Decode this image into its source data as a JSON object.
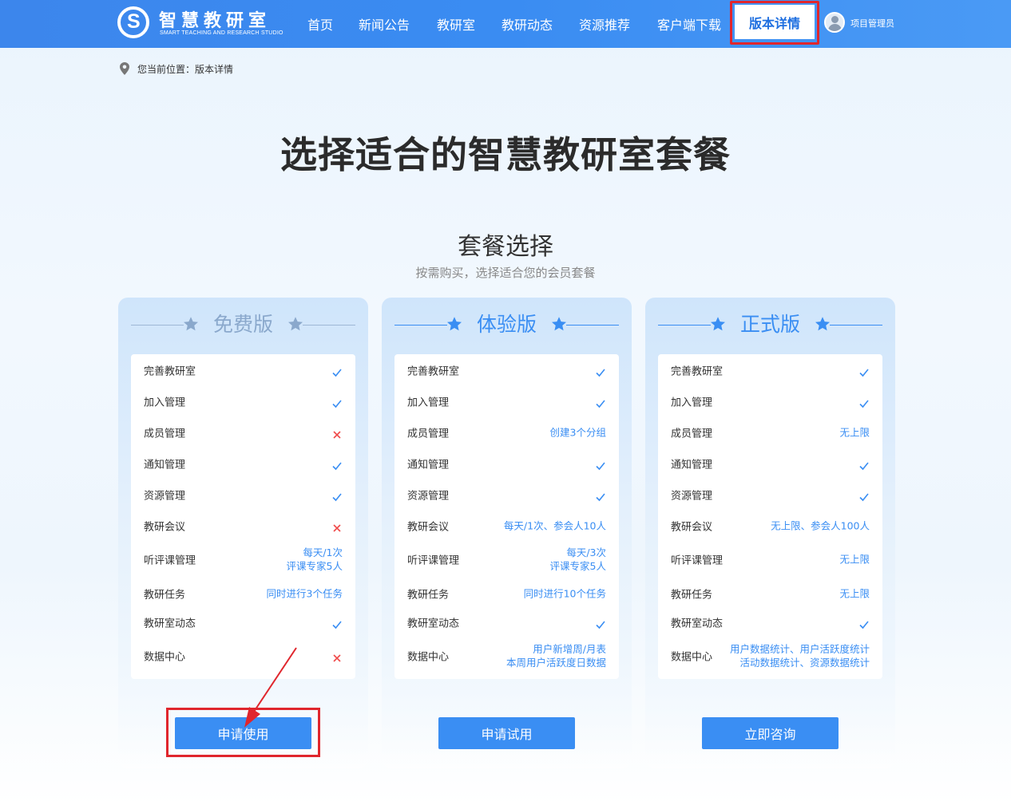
{
  "colors": {
    "brand_blue": "#3a8ef3",
    "nav_bg": "#3c86ec",
    "highlight_red": "#e0262d",
    "cross_red": "#f04a4a",
    "free_gray_blue": "#8aa8cc"
  },
  "header": {
    "logo_title": "智慧教研室",
    "logo_subtitle": "SMART TEACHING AND RESEARCH STUDIO",
    "nav": [
      "首页",
      "新闻公告",
      "教研室",
      "教研动态",
      "资源推荐",
      "客户端下载"
    ],
    "nav_active": "版本详情",
    "user_name": "项目管理员"
  },
  "breadcrumb": "您当前位置：版本详情",
  "hero_title": "选择适合的智慧教研室套餐",
  "section": {
    "title": "套餐选择",
    "subtitle": "按需购买，选择适合您的会员套餐"
  },
  "plans": [
    {
      "name": "免费版",
      "button": "申请使用",
      "features": [
        {
          "label": "完善教研室",
          "value": "",
          "mark": "check"
        },
        {
          "label": "加入管理",
          "value": "",
          "mark": "check"
        },
        {
          "label": "成员管理",
          "value": "",
          "mark": "cross"
        },
        {
          "label": "通知管理",
          "value": "",
          "mark": "check"
        },
        {
          "label": "资源管理",
          "value": "",
          "mark": "check"
        },
        {
          "label": "教研会议",
          "value": "",
          "mark": "cross"
        },
        {
          "label": "听评课管理",
          "value": "每天/1次\n评课专家5人",
          "mark": ""
        },
        {
          "label": "教研任务",
          "value": "同时进行3个任务",
          "mark": ""
        },
        {
          "label": "教研室动态",
          "value": "",
          "mark": "check"
        },
        {
          "label": "数据中心",
          "value": "",
          "mark": "cross"
        }
      ]
    },
    {
      "name": "体验版",
      "button": "申请试用",
      "features": [
        {
          "label": "完善教研室",
          "value": "",
          "mark": "check"
        },
        {
          "label": "加入管理",
          "value": "",
          "mark": "check"
        },
        {
          "label": "成员管理",
          "value": "创建3个分组",
          "mark": ""
        },
        {
          "label": "通知管理",
          "value": "",
          "mark": "check"
        },
        {
          "label": "资源管理",
          "value": "",
          "mark": "check"
        },
        {
          "label": "教研会议",
          "value": "每天/1次、参会人10人",
          "mark": ""
        },
        {
          "label": "听评课管理",
          "value": "每天/3次\n评课专家5人",
          "mark": ""
        },
        {
          "label": "教研任务",
          "value": "同时进行10个任务",
          "mark": ""
        },
        {
          "label": "教研室动态",
          "value": "",
          "mark": "check"
        },
        {
          "label": "数据中心",
          "value": "用户新增周/月表\n本周用户活跃度日数据",
          "mark": ""
        }
      ]
    },
    {
      "name": "正式版",
      "button": "立即咨询",
      "features": [
        {
          "label": "完善教研室",
          "value": "",
          "mark": "check"
        },
        {
          "label": "加入管理",
          "value": "",
          "mark": "check"
        },
        {
          "label": "成员管理",
          "value": "无上限",
          "mark": ""
        },
        {
          "label": "通知管理",
          "value": "",
          "mark": "check"
        },
        {
          "label": "资源管理",
          "value": "",
          "mark": "check"
        },
        {
          "label": "教研会议",
          "value": "无上限、参会人100人",
          "mark": ""
        },
        {
          "label": "听评课管理",
          "value": "无上限",
          "mark": ""
        },
        {
          "label": "教研任务",
          "value": "无上限",
          "mark": ""
        },
        {
          "label": "教研室动态",
          "value": "",
          "mark": "check"
        },
        {
          "label": "数据中心",
          "value": "用户数据统计、用户活跃度统计\n活动数据统计、资源数据统计",
          "mark": ""
        }
      ]
    }
  ]
}
